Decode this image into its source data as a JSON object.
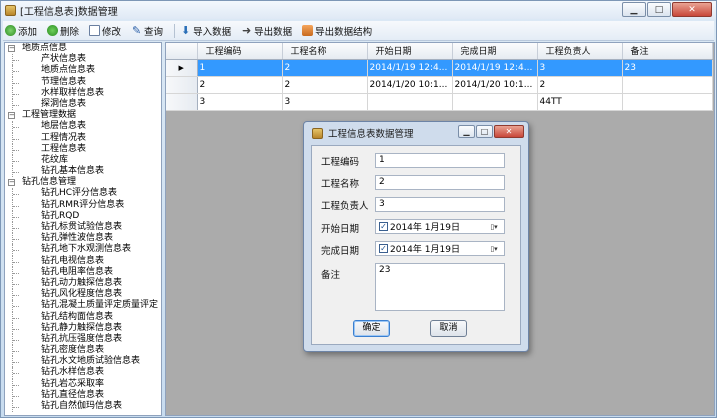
{
  "window": {
    "title": "[工程信息表]数据管理"
  },
  "toolbar": {
    "add": "添加",
    "delete": "删除",
    "edit": "修改",
    "query": "查询",
    "import": "导入数据",
    "export": "导出数据",
    "export_struct": "导出数据结构"
  },
  "tree": [
    {
      "label": "地质点信息",
      "level": 0,
      "box": "−"
    },
    {
      "label": "产状信息表",
      "level": 1
    },
    {
      "label": "地质点信息表",
      "level": 1
    },
    {
      "label": "节理信息表",
      "level": 1
    },
    {
      "label": "水样取样信息表",
      "level": 1
    },
    {
      "label": "探洞信息表",
      "level": 1
    },
    {
      "label": "工程管理数据",
      "level": 0,
      "box": "−"
    },
    {
      "label": "地层信息表",
      "level": 1
    },
    {
      "label": "工程情况表",
      "level": 1
    },
    {
      "label": "工程信息表",
      "level": 1
    },
    {
      "label": "花纹库",
      "level": 1
    },
    {
      "label": "钻孔基本信息表",
      "level": 1
    },
    {
      "label": "钻孔信息管理",
      "level": 0,
      "box": "−"
    },
    {
      "label": "钻孔HC评分信息表",
      "level": 1
    },
    {
      "label": "钻孔RMR评分信息表",
      "level": 1
    },
    {
      "label": "钻孔RQD",
      "level": 1
    },
    {
      "label": "钻孔标贯试验信息表",
      "level": 1
    },
    {
      "label": "钻孔弹性波信息表",
      "level": 1
    },
    {
      "label": "钻孔地下水观测信息表",
      "level": 1
    },
    {
      "label": "钻孔电视信息表",
      "level": 1
    },
    {
      "label": "钻孔电阻率信息表",
      "level": 1
    },
    {
      "label": "钻孔动力触探信息表",
      "level": 1
    },
    {
      "label": "钻孔风化程度信息表",
      "level": 1
    },
    {
      "label": "钻孔混凝土质量评定质量评定",
      "level": 1
    },
    {
      "label": "钻孔结构面信息表",
      "level": 1
    },
    {
      "label": "钻孔静力触探信息表",
      "level": 1
    },
    {
      "label": "钻孔抗压强度信息表",
      "level": 1
    },
    {
      "label": "钻孔密度信息表",
      "level": 1
    },
    {
      "label": "钻孔水文地质试验信息表",
      "level": 1
    },
    {
      "label": "钻孔水样信息表",
      "level": 1
    },
    {
      "label": "钻孔岩芯采取率",
      "level": 1
    },
    {
      "label": "钻孔直径信息表",
      "level": 1
    },
    {
      "label": "钻孔自然伽玛信息表",
      "level": 1
    }
  ],
  "grid": {
    "columns": [
      "工程编码",
      "工程名称",
      "开始日期",
      "完成日期",
      "工程负责人",
      "备注"
    ],
    "rows": [
      [
        "1",
        "2",
        "2014/1/19 12:4...",
        "2014/1/19 12:4...",
        "3",
        "23"
      ],
      [
        "2",
        "2",
        "2014/1/20 10:1...",
        "2014/1/20 10:1...",
        "2",
        ""
      ],
      [
        "3",
        "3",
        "",
        "",
        "44TT",
        ""
      ]
    ],
    "selected_row_marker": "▶"
  },
  "dialog": {
    "title": "工程信息表数据管理",
    "fields": {
      "code_label": "工程编码",
      "code_value": "1",
      "name_label": "工程名称",
      "name_value": "2",
      "owner_label": "工程负责人",
      "owner_value": "3",
      "start_label": "开始日期",
      "start_value": "2014年  1月19日",
      "end_label": "完成日期",
      "end_value": "2014年  1月19日",
      "note_label": "备注",
      "note_value": "23"
    },
    "ok": "确定",
    "cancel": "取消"
  },
  "colors": {
    "selection": "#3399ff",
    "grid_background": "#ababab"
  }
}
